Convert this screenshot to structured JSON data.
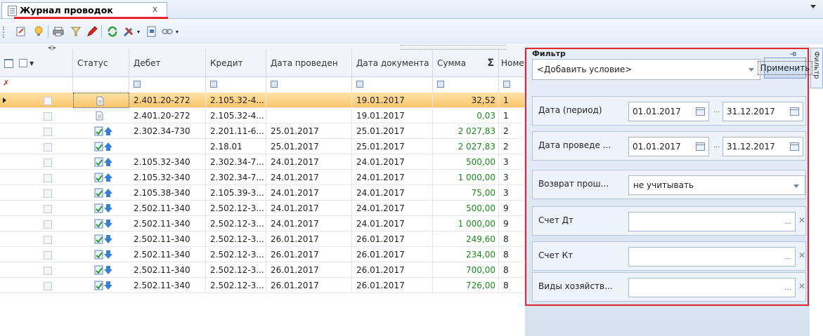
{
  "tab": {
    "title": "Журнал проводок",
    "close": "x"
  },
  "grid": {
    "columns": [
      "Статус",
      "Дебет",
      "Кредит",
      "Дата проведен",
      "Дата документа",
      "Сумма",
      "Номе"
    ],
    "sum_symbol": "Σ",
    "scroll_hint": "◂||▸",
    "rows": [
      {
        "status": "doc",
        "debit": "2.401.20-272",
        "credit": "2.105.32-4...",
        "date_post": "",
        "date_doc": "19.01.2017",
        "sum": "32,52",
        "num": "1",
        "selected": true
      },
      {
        "status": "doc",
        "debit": "2.401.20-272",
        "credit": "2.105.32-4...",
        "date_post": "",
        "date_doc": "19.01.2017",
        "sum": "0,03",
        "num": "1"
      },
      {
        "status": "up",
        "debit": "2.302.34-730",
        "credit": "2.201.11-6...",
        "date_post": "25.01.2017",
        "date_doc": "25.01.2017",
        "sum": "2 027,83",
        "num": "2"
      },
      {
        "status": "up",
        "debit": "",
        "credit": "2.18.01",
        "date_post": "25.01.2017",
        "date_doc": "25.01.2017",
        "sum": "2 027,83",
        "num": "2"
      },
      {
        "status": "up",
        "debit": "2.105.32-340",
        "credit": "2.302.34-7...",
        "date_post": "24.01.2017",
        "date_doc": "24.01.2017",
        "sum": "500,00",
        "num": "3"
      },
      {
        "status": "up",
        "debit": "2.105.32-340",
        "credit": "2.302.34-7...",
        "date_post": "24.01.2017",
        "date_doc": "24.01.2017",
        "sum": "1 000,00",
        "num": "3"
      },
      {
        "status": "up",
        "debit": "2.105.38-340",
        "credit": "2.105.39-3...",
        "date_post": "24.01.2017",
        "date_doc": "24.01.2017",
        "sum": "75,00",
        "num": "3"
      },
      {
        "status": "down",
        "debit": "2.502.11-340",
        "credit": "2.502.12-3...",
        "date_post": "24.01.2017",
        "date_doc": "24.01.2017",
        "sum": "500,00",
        "num": "9"
      },
      {
        "status": "down",
        "debit": "2.502.11-340",
        "credit": "2.502.12-3...",
        "date_post": "24.01.2017",
        "date_doc": "24.01.2017",
        "sum": "1 000,00",
        "num": "9"
      },
      {
        "status": "down",
        "debit": "2.502.11-340",
        "credit": "2.502.12-3...",
        "date_post": "26.01.2017",
        "date_doc": "26.01.2017",
        "sum": "249,60",
        "num": "8"
      },
      {
        "status": "down",
        "debit": "2.502.11-340",
        "credit": "2.502.12-3...",
        "date_post": "26.01.2017",
        "date_doc": "26.01.2017",
        "sum": "234,00",
        "num": "8"
      },
      {
        "status": "down",
        "debit": "2.502.11-340",
        "credit": "2.502.12-3...",
        "date_post": "26.01.2017",
        "date_doc": "26.01.2017",
        "sum": "700,00",
        "num": "8"
      },
      {
        "status": "down",
        "debit": "2.502.11-340",
        "credit": "2.502.12-3...",
        "date_post": "26.01.2017",
        "date_doc": "26.01.2017",
        "sum": "726,00",
        "num": "8"
      }
    ]
  },
  "filter": {
    "title": "Фильтр",
    "side_tab": "Фильтр",
    "add_condition": "<Добавить условие>",
    "apply": "Применить",
    "conditions": {
      "date_period": {
        "label": "Дата (период)",
        "from": "01.01.2017",
        "to": "31.12.2017"
      },
      "date_post": {
        "label": "Дата проведе ...",
        "from": "01.01.2017",
        "to": "31.12.2017"
      },
      "return": {
        "label": "Возврат прош...",
        "value": "не учитывать"
      },
      "acc_dt": {
        "label": "Счет Дт"
      },
      "acc_kt": {
        "label": "Счет Кт"
      },
      "types": {
        "label": "Виды хозяйств..."
      }
    },
    "range_dots": "...",
    "ellipsis": "...",
    "clear": "✕"
  },
  "colors": {
    "accent_red": "#e0262d",
    "green_sum": "#1b8a1b",
    "selected_row": "#fbc66a"
  }
}
